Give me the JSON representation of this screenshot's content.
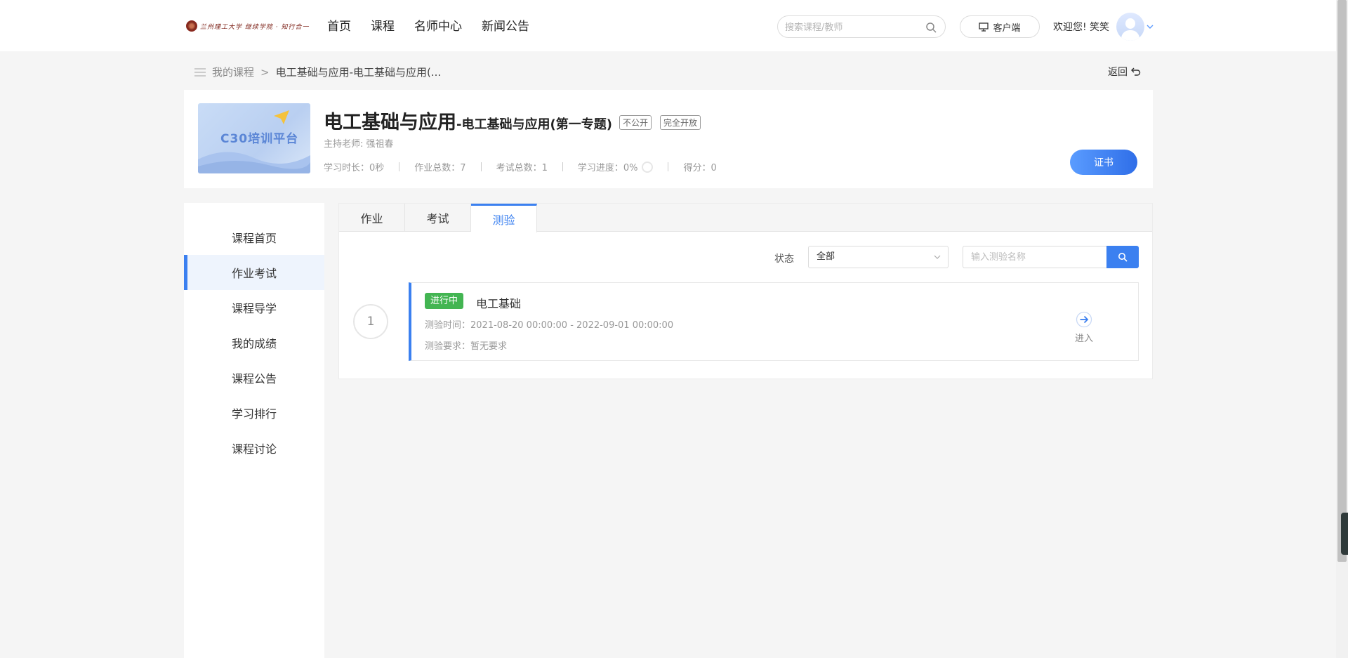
{
  "header": {
    "logo_text": "兰州理工大学 继续学院 · 知行合一",
    "nav": [
      "首页",
      "课程",
      "名师中心",
      "新闻公告"
    ],
    "search_placeholder": "搜索课程/教师",
    "client_label": "客户端",
    "welcome": "欢迎您!  笑笑"
  },
  "breadcrumb": {
    "root": "我的课程",
    "separator": ">",
    "current": "电工基础与应用-电工基础与应用(...",
    "back_label": "返回"
  },
  "course": {
    "cover_title": "C30培训平台",
    "title_main": "电工基础与应用",
    "title_sub": "-电工基础与应用(第一专题)",
    "tags": [
      "不公开",
      "完全开放"
    ],
    "teacher": "主持老师: 强祖春",
    "stats": {
      "study_time": "学习时长：0秒",
      "homework_total": "作业总数：7",
      "exam_total": "考试总数：1",
      "progress": "学习进度：0%",
      "score": "得分：0"
    },
    "progress_value": 0,
    "certificate_label": "证书"
  },
  "sidebar": {
    "items": [
      "课程首页",
      "作业考试",
      "课程导学",
      "我的成绩",
      "课程公告",
      "学习排行",
      "课程讨论"
    ],
    "active_index": 1
  },
  "panel": {
    "tabs": [
      "作业",
      "考试",
      "测验"
    ],
    "active_tab": 2,
    "filter_label": "状态",
    "filter_value": "全部",
    "query_placeholder": "输入测验名称"
  },
  "quizzes": [
    {
      "index": "1",
      "status": "进行中",
      "name": "电工基础",
      "time": "测验时间：2021-08-20 00:00:00 - 2022-09-01 00:00:00",
      "requirement": "测验要求：暂无要求",
      "enter_label": "进入"
    }
  ],
  "colors": {
    "accent": "#3b80f0",
    "status_green": "#43b552",
    "page_bg": "#f5f5f5"
  }
}
